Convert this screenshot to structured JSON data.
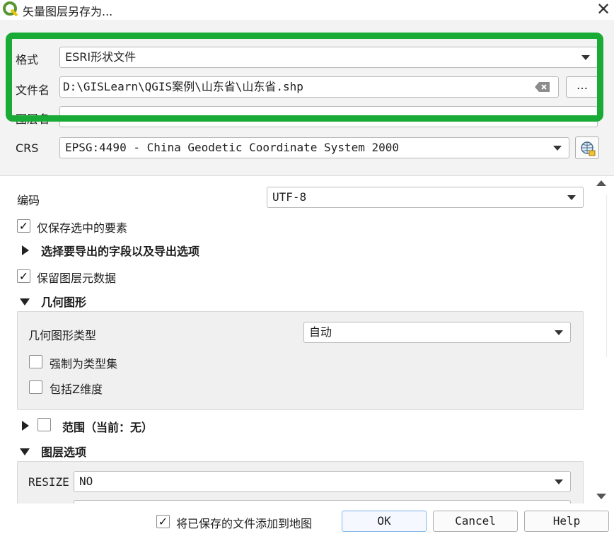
{
  "window": {
    "title": "矢量图层另存为...",
    "close_glyph": "✕"
  },
  "upper": {
    "format_label": "格式",
    "format_value": "ESRI形状文件",
    "filename_label": "文件名",
    "filename_value": "D:\\GISLearn\\QGIS案例\\山东省\\山东省.shp",
    "browse_label": "…",
    "layername_label": "图层名",
    "crs_label": "CRS",
    "crs_value": "EPSG:4490 - China Geodetic Coordinate System 2000"
  },
  "options": {
    "encoding_label": "编码",
    "encoding_value": "UTF-8",
    "save_selected_label": "仅保存选中的要素",
    "save_selected_checked": true,
    "select_fields_label": "选择要导出的字段以及导出选项",
    "persist_metadata_label": "保留图层元数据",
    "persist_metadata_checked": true,
    "geometry_section_label": "几何图形",
    "geometry_type_label": "几何图形类型",
    "geometry_type_value": "自动",
    "force_multi_label": "强制为类型集",
    "include_z_label": "包括Z维度",
    "extent_label": "范围（当前：无）",
    "layer_options_label": "图层选项",
    "resize_label": "RESIZE",
    "resize_value": "NO"
  },
  "footer": {
    "add_to_map_label": "将已保存的文件添加到地图",
    "add_to_map_checked": true,
    "ok_label": "OK",
    "cancel_label": "Cancel",
    "help_label": "Help"
  },
  "colors": {
    "highlight_border": "#1aaa36",
    "qgis_icon_green": "#589632"
  },
  "icons": [
    "qgis-app-icon",
    "close-icon",
    "clear-input-icon",
    "crs-selector-icon",
    "chevron-down-icon",
    "checkmark-icon",
    "expand-arrow-icon",
    "collapse-arrow-icon",
    "scroll-up-icon",
    "scroll-down-icon"
  ]
}
